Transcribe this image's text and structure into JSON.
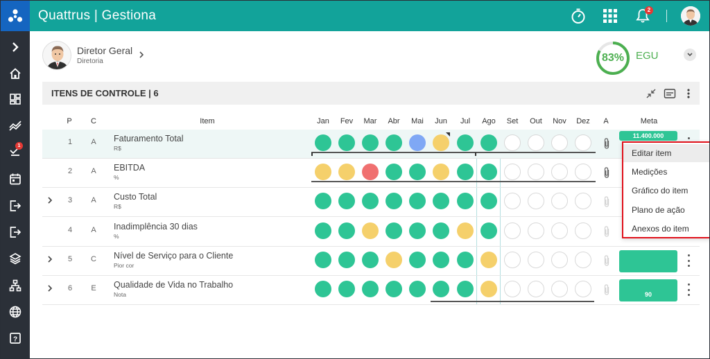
{
  "app": {
    "title": "Quattrus | Gestiona",
    "notifications": "2"
  },
  "sidebar": {
    "icons": [
      "chevron-right-icon",
      "home-icon",
      "dashboard-icon",
      "trend-icon",
      "tasks-icon",
      "calendar-icon",
      "export-icon",
      "export-alt-icon",
      "layers-icon",
      "org-chart-icon",
      "globe-icon",
      "help-icon"
    ],
    "tasks_badge": "1"
  },
  "user": {
    "name": "Diretor Geral",
    "department": "Diretoria",
    "score": "83%",
    "score_fraction": 0.83,
    "score_label": "EGU"
  },
  "section": {
    "title": "ITENS DE CONTROLE | 6"
  },
  "table": {
    "headers": {
      "p": "P",
      "c": "C",
      "item": "Item",
      "a": "A",
      "meta": "Meta"
    },
    "months": [
      "Jan",
      "Fev",
      "Mar",
      "Abr",
      "Mai",
      "Jun",
      "Jul",
      "Ago",
      "Set",
      "Out",
      "Nov",
      "Dez"
    ],
    "rows": [
      {
        "p": "1",
        "c": "A",
        "name": "Faturamento Total",
        "unit": "R$",
        "expandable": false,
        "meta": "11.400.000",
        "status": [
          "green",
          "green",
          "green",
          "green",
          "blue",
          "yellow",
          "green",
          "green",
          "empty",
          "empty",
          "empty",
          "empty"
        ]
      },
      {
        "p": "2",
        "c": "A",
        "name": "EBITDA",
        "unit": "%",
        "expandable": false,
        "meta": "",
        "status": [
          "yellow",
          "yellow",
          "red",
          "green",
          "green",
          "yellow",
          "green",
          "green",
          "empty",
          "empty",
          "empty",
          "empty"
        ]
      },
      {
        "p": "3",
        "c": "A",
        "name": "Custo Total",
        "unit": "R$",
        "expandable": true,
        "meta": "",
        "status": [
          "green",
          "green",
          "green",
          "green",
          "green",
          "green",
          "green",
          "green",
          "empty",
          "empty",
          "empty",
          "empty"
        ]
      },
      {
        "p": "4",
        "c": "A",
        "name": "Inadimplência 30 dias",
        "unit": "%",
        "expandable": false,
        "meta": "",
        "status": [
          "green",
          "green",
          "yellow",
          "green",
          "green",
          "green",
          "yellow",
          "green",
          "empty",
          "empty",
          "empty",
          "empty"
        ]
      },
      {
        "p": "5",
        "c": "C",
        "name": "Nível de Serviço para o Cliente",
        "unit": "Pior cor",
        "expandable": true,
        "meta": "",
        "status": [
          "green",
          "green",
          "green",
          "yellow",
          "green",
          "green",
          "green",
          "yellow",
          "empty",
          "empty",
          "empty",
          "empty"
        ]
      },
      {
        "p": "6",
        "c": "E",
        "name": "Qualidade de Vida no Trabalho",
        "unit": "Nota",
        "expandable": true,
        "meta": "90",
        "status": [
          "green",
          "green",
          "green",
          "green",
          "green",
          "green",
          "green",
          "yellow",
          "empty",
          "empty",
          "empty",
          "empty"
        ]
      }
    ]
  },
  "context_menu": {
    "items": [
      "Editar item",
      "Medições",
      "Gráfico do item",
      "Plano de ação",
      "Anexos do item"
    ],
    "hovered": "Editar item"
  },
  "colors": {
    "topbar": "#12a39a",
    "green": "#2ec595",
    "yellow": "#f5d06b",
    "red": "#f07070",
    "blue": "#7fa8f5",
    "highlight_border": "#e0101a"
  }
}
